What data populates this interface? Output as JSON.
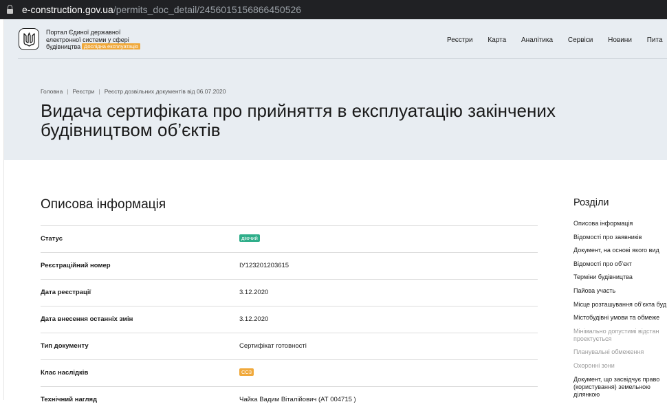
{
  "browser": {
    "url_host": "e-construction.gov.ua",
    "url_path": "/permits_doc_detail/2456015156866450526"
  },
  "header": {
    "brand_line1": "Портал Єдиної державної",
    "brand_line2": "електронної системи у сфері",
    "brand_line3": "будівництва",
    "beta_badge": "Дослідна експлуатація",
    "nav": [
      "Реєстри",
      "Карта",
      "Аналітика",
      "Сервіси",
      "Новини",
      "Пита"
    ]
  },
  "breadcrumb": [
    "Головна",
    "Реєстри",
    "Реєстр дозвільних документів від 06.07.2020"
  ],
  "page_title": "Видача сертифіката про прийняття в експлуатацію закінчених будівництвом об’єктів",
  "section": {
    "title": "Описова інформація",
    "rows": [
      {
        "label": "Статус",
        "value": "діючий",
        "badge": "green"
      },
      {
        "label": "Реєстраційний номер",
        "value": "ІУ123201203615"
      },
      {
        "label": "Дата реєстрації",
        "value": "3.12.2020"
      },
      {
        "label": "Дата внесення останніх змін",
        "value": "3.12.2020"
      },
      {
        "label": "Тип документу",
        "value": "Сертифікат готовності"
      },
      {
        "label": "Клас наслідків",
        "value": "СС3",
        "badge": "orange"
      },
      {
        "label": "Технічний нагляд",
        "value": "Чайка Вадим Віталійович (АТ 004715 )"
      }
    ]
  },
  "sidebar": {
    "title": "Розділи",
    "items": [
      {
        "label": "Описова інформація"
      },
      {
        "label": "Відомості про заявників"
      },
      {
        "label": "Документ, на основі якого вид"
      },
      {
        "label": "Відомості про об’єкт"
      },
      {
        "label": "Терміни будівництва"
      },
      {
        "label": "Пайова участь"
      },
      {
        "label": "Місце розташування об’єкта буд"
      },
      {
        "label": "Містобудівні умови та обмеже"
      },
      {
        "label": "Мінімально допустимі відстан проектується",
        "muted": true,
        "two": true
      },
      {
        "label": "Планувальні обмеження",
        "muted": true
      },
      {
        "label": "Охоронні зони",
        "muted": true
      },
      {
        "label": "Документ, що засвідчує право (користування) земельною ділянкою",
        "two": true
      }
    ]
  }
}
